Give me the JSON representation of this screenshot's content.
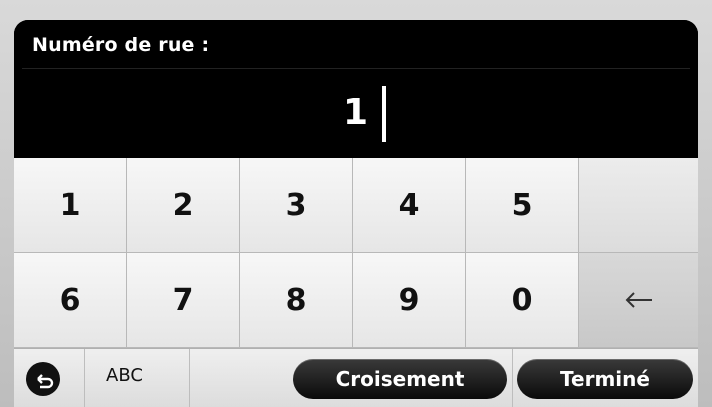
{
  "prompt": "Numéro de rue :",
  "entry_value": "1",
  "keypad": {
    "row1": [
      "1",
      "2",
      "3",
      "4",
      "5",
      ""
    ],
    "row2": [
      "6",
      "7",
      "8",
      "9",
      "0"
    ]
  },
  "icons": {
    "backspace": "backspace-arrow-icon",
    "back": "back-arrow-icon"
  },
  "toolbar": {
    "abc_label": "ABC",
    "crossing_label": "Croisement",
    "done_label": "Terminé"
  },
  "colors": {
    "header_bg": "#000000",
    "keypad_bg": "#e4e4e4",
    "pill_bg": "#111111"
  }
}
